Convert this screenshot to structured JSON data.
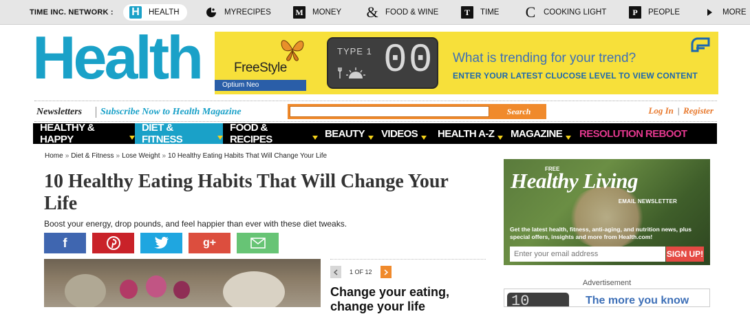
{
  "network": {
    "label": "TIME INC. NETWORK :",
    "items": [
      {
        "label": "HEALTH",
        "icon": "health-logo-icon",
        "glyph": "H"
      },
      {
        "label": "MYRECIPES",
        "icon": "myrecipes-icon"
      },
      {
        "label": "MONEY",
        "icon": "money-icon",
        "glyph": "M"
      },
      {
        "label": "FOOD & WINE",
        "icon": "ampersand-icon",
        "glyph": "&"
      },
      {
        "label": "TIME",
        "icon": "time-icon",
        "glyph": "T"
      },
      {
        "label": "COOKING LIGHT",
        "icon": "cooking-light-icon",
        "glyph": "C"
      },
      {
        "label": "PEOPLE",
        "icon": "people-icon",
        "glyph": "P"
      },
      {
        "label": "MORE",
        "icon": "play-triangle-icon"
      }
    ]
  },
  "logo": "Health",
  "ad": {
    "brand": "FreeStyle",
    "brand_sub": "Optium Neo",
    "meter_label": "TYPE 1",
    "meter_value": "00",
    "headline": "What is trending for your trend?",
    "cta": "ENTER YOUR LATEST CLUCOSE LEVEL TO VIEW CONTENT"
  },
  "newsletter": {
    "label": "Newsletters",
    "subscribe": "Subscribe Now to Health Magazine"
  },
  "search": {
    "placeholder": "",
    "button": "Search"
  },
  "auth": {
    "login": "Log In",
    "separator": "|",
    "register": "Register"
  },
  "nav": [
    {
      "label": "HEALTHY & HAPPY"
    },
    {
      "label": "DIET & FITNESS"
    },
    {
      "label": "FOOD & RECIPES"
    },
    {
      "label": "BEAUTY"
    },
    {
      "label": "VIDEOS"
    },
    {
      "label": "HEALTH A-Z"
    },
    {
      "label": "MAGAZINE"
    },
    {
      "label": "RESOLUTION REBOOT"
    }
  ],
  "breadcrumb": [
    "Home",
    "Diet & Fitness",
    "Lose Weight",
    "10 Healthy Eating Habits That Will Change Your Life"
  ],
  "breadcrumb_sep": "»",
  "article": {
    "title": "10 Healthy Eating Habits That Will Change Your Life",
    "description": "Boost your energy, drop pounds, and feel happier than ever with these diet tweaks.",
    "pager": "1 OF 12",
    "slide_heading": "Change your eating, change your life"
  },
  "share": {
    "facebook": "f",
    "googleplus": "g+"
  },
  "rail": {
    "free": "FREE",
    "headline": "Healthy Living",
    "email_newsletter": "EMAIL NEWSLETTER",
    "blurb": "Get the latest health, fitness, anti-aging, and nutrition news, plus special offers, insights and more from Health.com!",
    "email_placeholder": "Enter your email address",
    "signup": "SIGN UP!",
    "advertisement": "Advertisement",
    "ad_text": "The more you know",
    "ad_meter": "10"
  },
  "colors": {
    "brand": "#1aa1c8",
    "orange": "#f08a2c",
    "ad_yellow": "#f7e03a",
    "nav_pink": "#e3388e"
  }
}
